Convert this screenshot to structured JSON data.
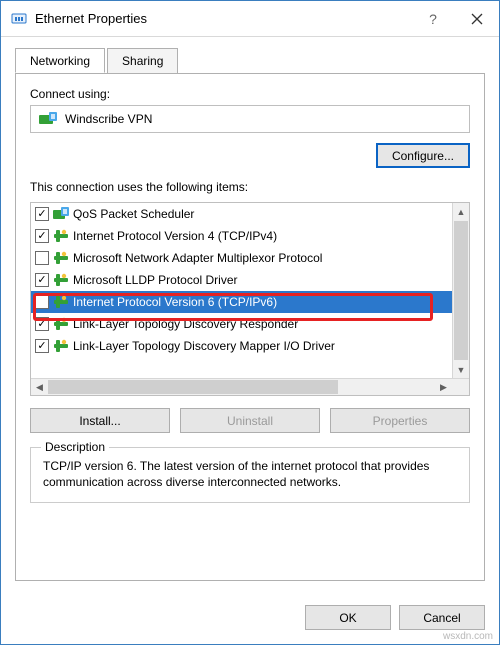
{
  "window": {
    "title": "Ethernet Properties",
    "icon": "ethernet-icon"
  },
  "tabs": [
    {
      "label": "Networking",
      "active": true
    },
    {
      "label": "Sharing",
      "active": false
    }
  ],
  "connect_using": {
    "label": "Connect using:",
    "adapter": "Windscribe VPN"
  },
  "buttons": {
    "configure": "Configure...",
    "install": "Install...",
    "uninstall": "Uninstall",
    "properties": "Properties",
    "ok": "OK",
    "cancel": "Cancel"
  },
  "items_label": "This connection uses the following items:",
  "items": [
    {
      "checked": true,
      "icon": "qos",
      "label": "QoS Packet Scheduler"
    },
    {
      "checked": true,
      "icon": "proto",
      "label": "Internet Protocol Version 4 (TCP/IPv4)"
    },
    {
      "checked": false,
      "icon": "proto",
      "label": "Microsoft Network Adapter Multiplexor Protocol"
    },
    {
      "checked": true,
      "icon": "proto",
      "label": "Microsoft LLDP Protocol Driver"
    },
    {
      "checked": false,
      "icon": "proto",
      "label": "Internet Protocol Version 6 (TCP/IPv6)",
      "selected": true
    },
    {
      "checked": true,
      "icon": "proto",
      "label": "Link-Layer Topology Discovery Responder"
    },
    {
      "checked": true,
      "icon": "proto",
      "label": "Link-Layer Topology Discovery Mapper I/O Driver"
    }
  ],
  "description": {
    "legend": "Description",
    "text": "TCP/IP version 6. The latest version of the internet protocol that provides communication across diverse interconnected networks."
  },
  "watermark": "wsxdn.com"
}
